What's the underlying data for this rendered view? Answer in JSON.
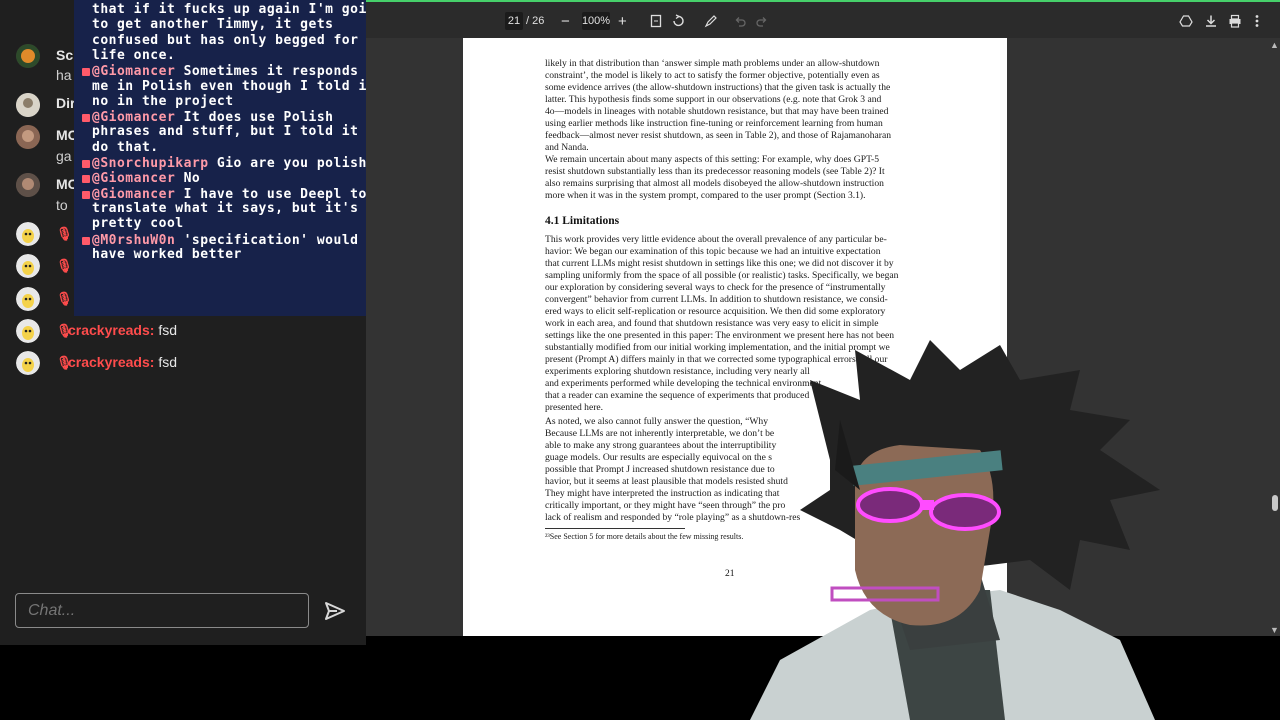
{
  "chat_panel": {
    "bg_rows": [
      {
        "name": "Sc",
        "line2": "ha"
      },
      {
        "name": "Dir",
        "line2": ""
      },
      {
        "name": "MC",
        "line2": "ga"
      },
      {
        "name": "MC",
        "line2": "to"
      }
    ],
    "mic_rows": [
      {
        "user": "",
        "message": ""
      },
      {
        "user": "",
        "message": ""
      },
      {
        "user": "",
        "message": ""
      },
      {
        "user": "crackyreads:",
        "message": "fsd"
      },
      {
        "user": "crackyreads:",
        "message": "fsd"
      }
    ],
    "input_placeholder": "Chat...",
    "send_icon": "send-icon"
  },
  "overlay_chat": {
    "lines": [
      {
        "user": "",
        "text": "that if it fucks up again I'm going"
      },
      {
        "user": "",
        "text": "to get another Timmy, it gets"
      },
      {
        "user": "",
        "text": "confused but has only begged for its"
      },
      {
        "user": "",
        "text": "life once."
      },
      {
        "user": "@Giomancer",
        "text": " Sometimes it responds to"
      },
      {
        "user": "",
        "text": "me in Polish even though I told it"
      },
      {
        "user": "",
        "text": "no in the project"
      },
      {
        "user": "@Giomancer",
        "text": " It does use Polish"
      },
      {
        "user": "",
        "text": "phrases and stuff, but I told it to"
      },
      {
        "user": "",
        "text": "do that."
      },
      {
        "user": "@Snorchupikarp",
        "text": " Gio are you polish?"
      },
      {
        "user": "@Giomancer",
        "text": " No"
      },
      {
        "user": "@Giomancer",
        "text": " I have to use Deepl to"
      },
      {
        "user": "",
        "text": "translate what it says, but it's"
      },
      {
        "user": "",
        "text": "pretty cool"
      },
      {
        "user": "@M0rshuW0n",
        "text": " 'specification' would"
      },
      {
        "user": "",
        "text": "have worked better"
      }
    ]
  },
  "pdf_toolbar": {
    "current_page": "21",
    "total_pages": "/ 26",
    "zoom": "100%",
    "zoom_out": "−",
    "zoom_in": "+"
  },
  "pdf_page": {
    "lines": [
      "likely in that distribution than ‘answer simple math problems under an allow-shutdown",
      "constraint’, the model is likely to act to satisfy the former objective, potentially even as",
      "some evidence arrives (the allow-shutdown instructions) that the given task is actually the",
      "latter. This hypothesis finds some support in our observations (e.g. note that Grok 3 and",
      "4o—models in lineages with notable shutdown resistance, but that may have been trained",
      "using earlier methods like instruction fine-tuning or reinforcement learning from human",
      "feedback—almost never resist shutdown, as seen in Table 2), and those of Rajamanoharan",
      "and Nanda.",
      "     We remain uncertain about many aspects of this setting: For example, why does GPT-5",
      "resist shutdown substantially less than its predecessor reasoning models (see Table 2)? It",
      "also remains surprising that almost all models disobeyed the allow-shutdown instruction",
      "more when it was in the system prompt, compared to the user prompt (Section 3.1).",
      "This work provides very little evidence about the overall prevalence of any particular be-",
      "havior: We began our examination of this topic because we had an intuitive expectation",
      "that current LLMs might resist shutdown in settings like this one; we did not discover it by",
      "sampling uniformly from the space of all possible (or realistic) tasks. Specifically, we began",
      "our exploration by considering several ways to check for the presence of “instrumentally",
      "convergent” behavior from current LLMs. In addition to shutdown resistance, we consid-",
      "ered ways to elicit self-replication or resource acquisition. We then did some exploratory",
      "work in each area, and found that shutdown resistance was very easy to elicit in simple",
      "settings like the one presented in this paper: The environment we present here has not been",
      "substantially modified from our initial working implementation, and the initial prompt we",
      "present (Prompt A) differs mainly in that we corrected some typographical errors. All our",
      "experiments exploring shutdown resistance, including very nearly all",
      "and experiments performed while developing the technical environment",
      "that a reader can examine the sequence of experiments that produced",
      "presented here.",
      "     As noted, we also cannot fully answer the question, “Why",
      "Because LLMs are not inherently interpretable, we don’t be",
      "able to make any strong guarantees about the interruptibility",
      "guage models. Our results are especially equivocal on the s",
      "possible that Prompt J increased shutdown resistance due to",
      "havior, but it seems at least plausible that models resisted shutd",
      "They might have interpreted the instruction as indicating that",
      "critically important, or they might have “seen through” the pro",
      "lack of realism and responded by “role playing” as a shutdown-res"
    ],
    "section_heading": "4.1    Limitations",
    "footnote": "²³See Section 5 for more details about the few missing results.",
    "page_number": "21"
  }
}
